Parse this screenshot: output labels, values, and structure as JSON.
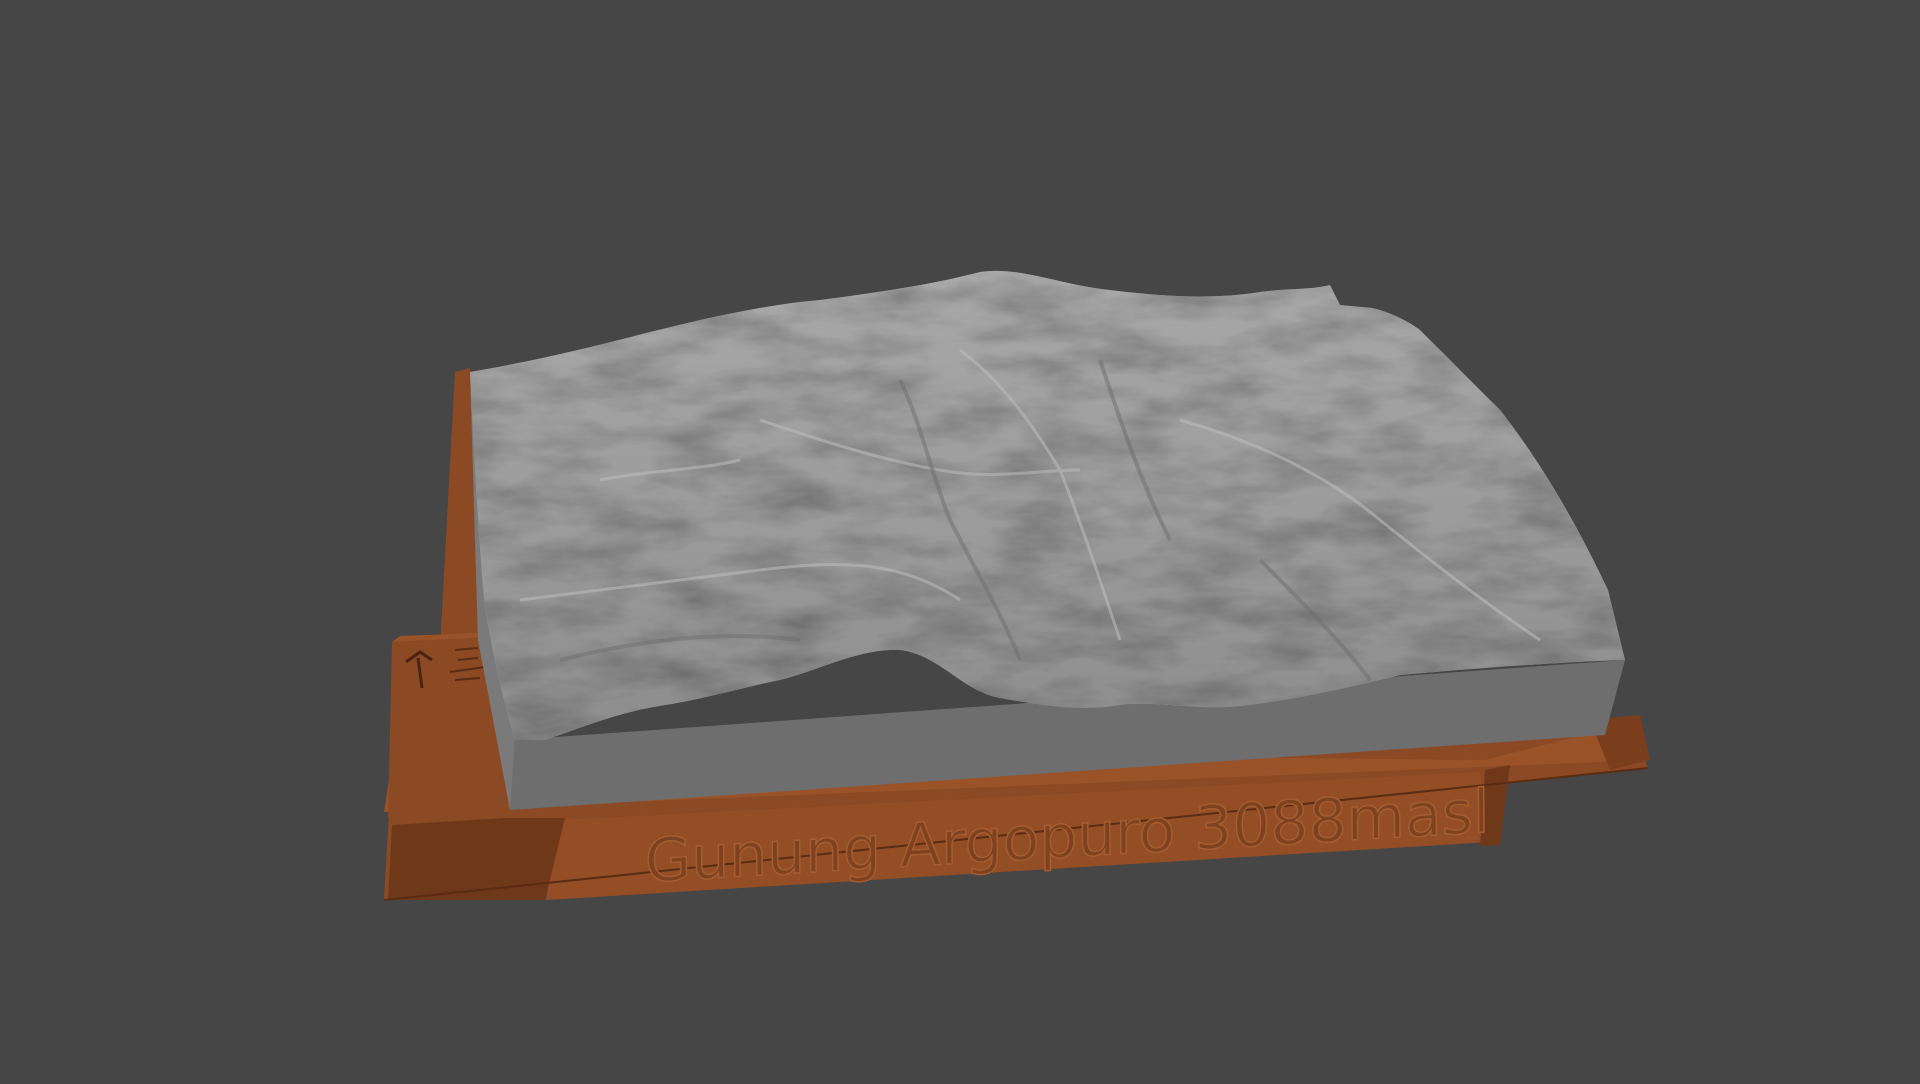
{
  "scene": {
    "background_color": "#464646",
    "model": {
      "base_color": "#8B4A24",
      "base_shade_color": "#6A3617",
      "terrain_color": "#9A9A9A",
      "terrain_side_color": "#6E6E6E",
      "engraved_label": "Gunung Argopuro 3088masl",
      "corner_marks": [
        "north-arrow-icon",
        "scale-bar-icon"
      ]
    }
  }
}
